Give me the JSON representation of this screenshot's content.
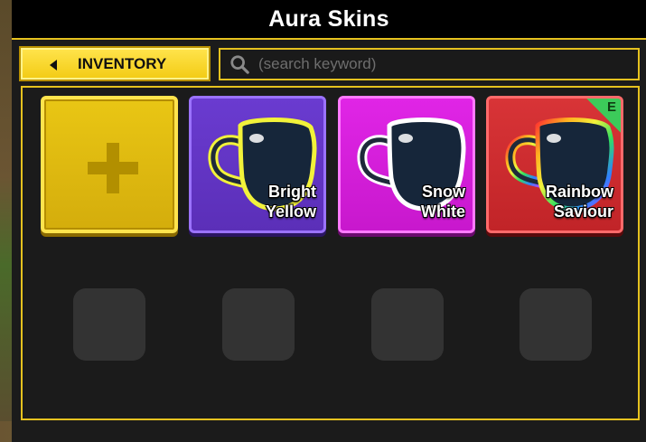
{
  "window": {
    "title": "Aura Skins"
  },
  "toolbar": {
    "inventory_label": "INVENTORY",
    "search_placeholder": "(search keyword)"
  },
  "colors": {
    "accent": "#e6c21f",
    "add_slot": "#e9c614",
    "purple_slot": "#6a3bd0",
    "magenta_slot": "#e025e6",
    "red_slot": "#d83437",
    "equipped_badge": "#3ccb5a"
  },
  "slots": [
    {
      "type": "add",
      "icon": "plus-icon"
    },
    {
      "type": "skin",
      "name_line1": "Bright",
      "name_line2": "Yellow",
      "icon": "mug-icon"
    },
    {
      "type": "skin",
      "name_line1": "Snow",
      "name_line2": "White",
      "icon": "mug-icon"
    },
    {
      "type": "skin",
      "name_line1": "Rainbow",
      "name_line2": "Saviour",
      "icon": "mug-icon",
      "badge": "E"
    }
  ],
  "empty_slots": 4
}
